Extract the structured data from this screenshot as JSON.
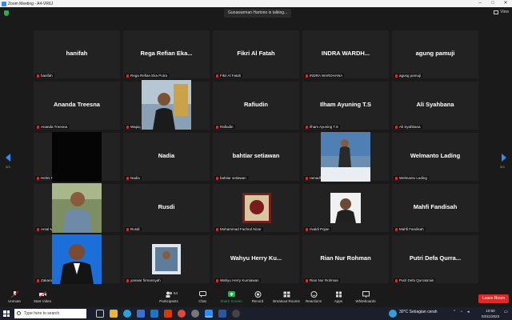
{
  "window": {
    "title": "Zoom Meeting - A4-VR6J",
    "view_label": "View"
  },
  "talking_indicator": "Gunawarman Hartono is talking...",
  "pagination": {
    "left": "3/3",
    "right": "3/3"
  },
  "tiles": [
    {
      "big": "hanifah",
      "name": "hanifah"
    },
    {
      "big": "Rega  Refian  Eka...",
      "name": "Rega Refian Eka Putra"
    },
    {
      "big": "Fikri Al Fatah",
      "name": "Fikri Al Fatah"
    },
    {
      "big": "INDRA  WARDH...",
      "name": "INDRA WARDHANA"
    },
    {
      "big": "agung pamuji",
      "name": "agung pamuji"
    },
    {
      "big": "Ananda Treesna",
      "name": "Ananda Treesna"
    },
    {
      "big": "",
      "name": "Wapiq RZ"
    },
    {
      "big": "Rafiudin",
      "name": "Rafiudin"
    },
    {
      "big": "Ilham Ayuning T.S",
      "name": "Ilham Ayuning T.S"
    },
    {
      "big": "Ali Syahbana",
      "name": "Ali Syahbana"
    },
    {
      "big": "",
      "name": "Helmi R.A"
    },
    {
      "big": "Nadia",
      "name": "Nadia"
    },
    {
      "big": "bahtiar setiawan",
      "name": "bahtiar setiawan"
    },
    {
      "big": "",
      "name": "ramadhan diramanda"
    },
    {
      "big": "Welmanto Lading",
      "name": "Welmanto Lading"
    },
    {
      "big": "",
      "name": "Arsal Marsuki"
    },
    {
      "big": "Rusdi",
      "name": "Rusdi"
    },
    {
      "big": "",
      "name": "Mohammad Fachrul Nizar"
    },
    {
      "big": "",
      "name": "rivaldi Pojan"
    },
    {
      "big": "Mahfi Fandisah",
      "name": "Mahfi Fandisah"
    },
    {
      "big": "",
      "name": "Zakaria Trismoyo"
    },
    {
      "big": "",
      "name": "yanwar firmansyah"
    },
    {
      "big": "Wahyu  Herry  Ku...",
      "name": "Wahyu Herry Kurniawan"
    },
    {
      "big": "Rian Nur Rohman",
      "name": "Rian Nur Rohman"
    },
    {
      "big": "Putri  Defa  Qurra...",
      "name": "Putri Defa Qurrata'ain"
    }
  ],
  "toolbar": {
    "unmute": "Unmute",
    "start_video": "Start Video",
    "participants": "Participants",
    "participants_count": "54",
    "chat": "Chat",
    "share_screen": "Share Screen",
    "record": "Record",
    "breakout_rooms": "Breakout Rooms",
    "reactions": "Reactions",
    "apps": "Apps",
    "whiteboards": "Whiteboards",
    "leave": "Leave Room"
  },
  "taskbar": {
    "search_placeholder": "Type here to search",
    "weather": "30°C  Sebagian cerah",
    "time": "10:50",
    "date": "03/11/2023"
  },
  "colors": {
    "accent": "#2d8cff",
    "share_green": "#22b14c",
    "leave_red": "#e02828"
  }
}
